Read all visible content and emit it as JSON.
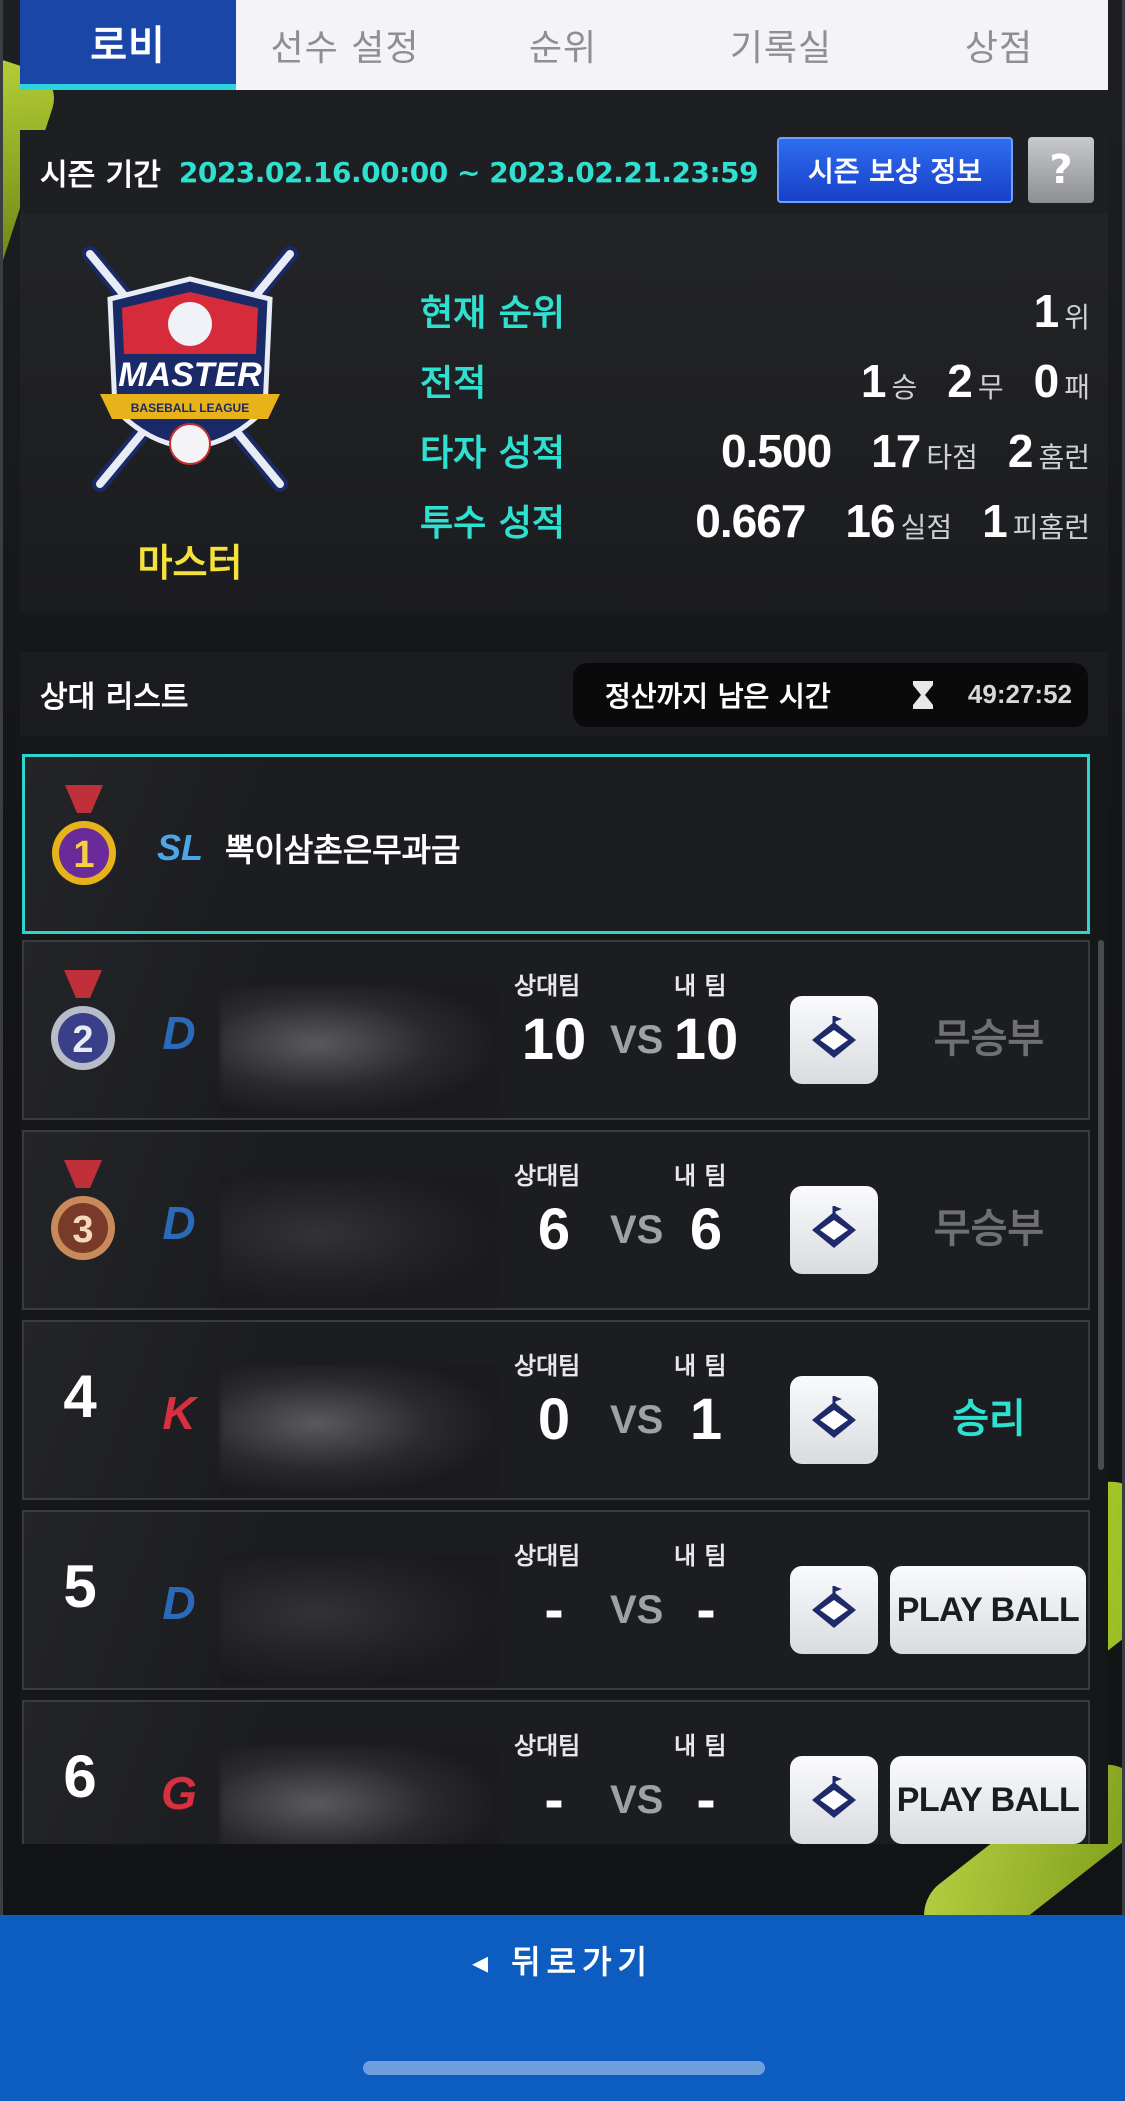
{
  "tabs": [
    {
      "label": "로비",
      "active": true
    },
    {
      "label": "선수 설정"
    },
    {
      "label": "순위"
    },
    {
      "label": "기록실"
    },
    {
      "label": "상점"
    }
  ],
  "season": {
    "label": "시즌 기간",
    "dates": "2023.02.16.00:00 ~ 2023.02.21.23:59",
    "reward_button": "시즌 보상 정보",
    "help_button": "?"
  },
  "tier": {
    "emblem_text": "MASTER",
    "emblem_subtext": "BASEBALL LEAGUE",
    "name": "마스터"
  },
  "stats": {
    "rank": {
      "label": "현재 순위",
      "value": "1",
      "unit": "위"
    },
    "record": {
      "label": "전적",
      "wins": "1",
      "wins_unit": "승",
      "draws": "2",
      "draws_unit": "무",
      "losses": "0",
      "losses_unit": "패"
    },
    "batting": {
      "label": "타자 성적",
      "avg": "0.500",
      "rbi": "17",
      "rbi_unit": "타점",
      "hr": "2",
      "hr_unit": "홈런"
    },
    "pitching": {
      "label": "투수 성적",
      "era": "0.667",
      "runs": "16",
      "runs_unit": "실점",
      "hr_allowed": "1",
      "hr_allowed_unit": "피홈런"
    }
  },
  "opponents": {
    "title": "상대 리스트",
    "timer_label": "정산까지 남은 시간",
    "timer_value": "49:27:52",
    "score_opp_label": "상대팀",
    "score_mine_label": "내 팀",
    "vs_label": "VS",
    "play_label": "PLAY BALL",
    "rows": [
      {
        "rank": "1",
        "team": "SL",
        "name": "뽁이삼촌은무과금",
        "self": true
      },
      {
        "rank": "2",
        "team": "D",
        "opp_score": "10",
        "my_score": "10",
        "result": "무승부"
      },
      {
        "rank": "3",
        "team": "D",
        "opp_score": "6",
        "my_score": "6",
        "result": "무승부"
      },
      {
        "rank": "4",
        "team": "K",
        "opp_score": "0",
        "my_score": "1",
        "result": "승리"
      },
      {
        "rank": "5",
        "team": "D",
        "opp_score": "-",
        "my_score": "-"
      },
      {
        "rank": "6",
        "team": "G",
        "opp_score": "-",
        "my_score": "-"
      }
    ]
  },
  "bottom": {
    "back_label": "◂ 뒤로가기"
  },
  "colors": {
    "accent_cyan": "#2fe0d0",
    "tab_active": "#1a46a8",
    "tier_gold": "#f5e23a",
    "bottom_bar": "#0d5cc0"
  }
}
